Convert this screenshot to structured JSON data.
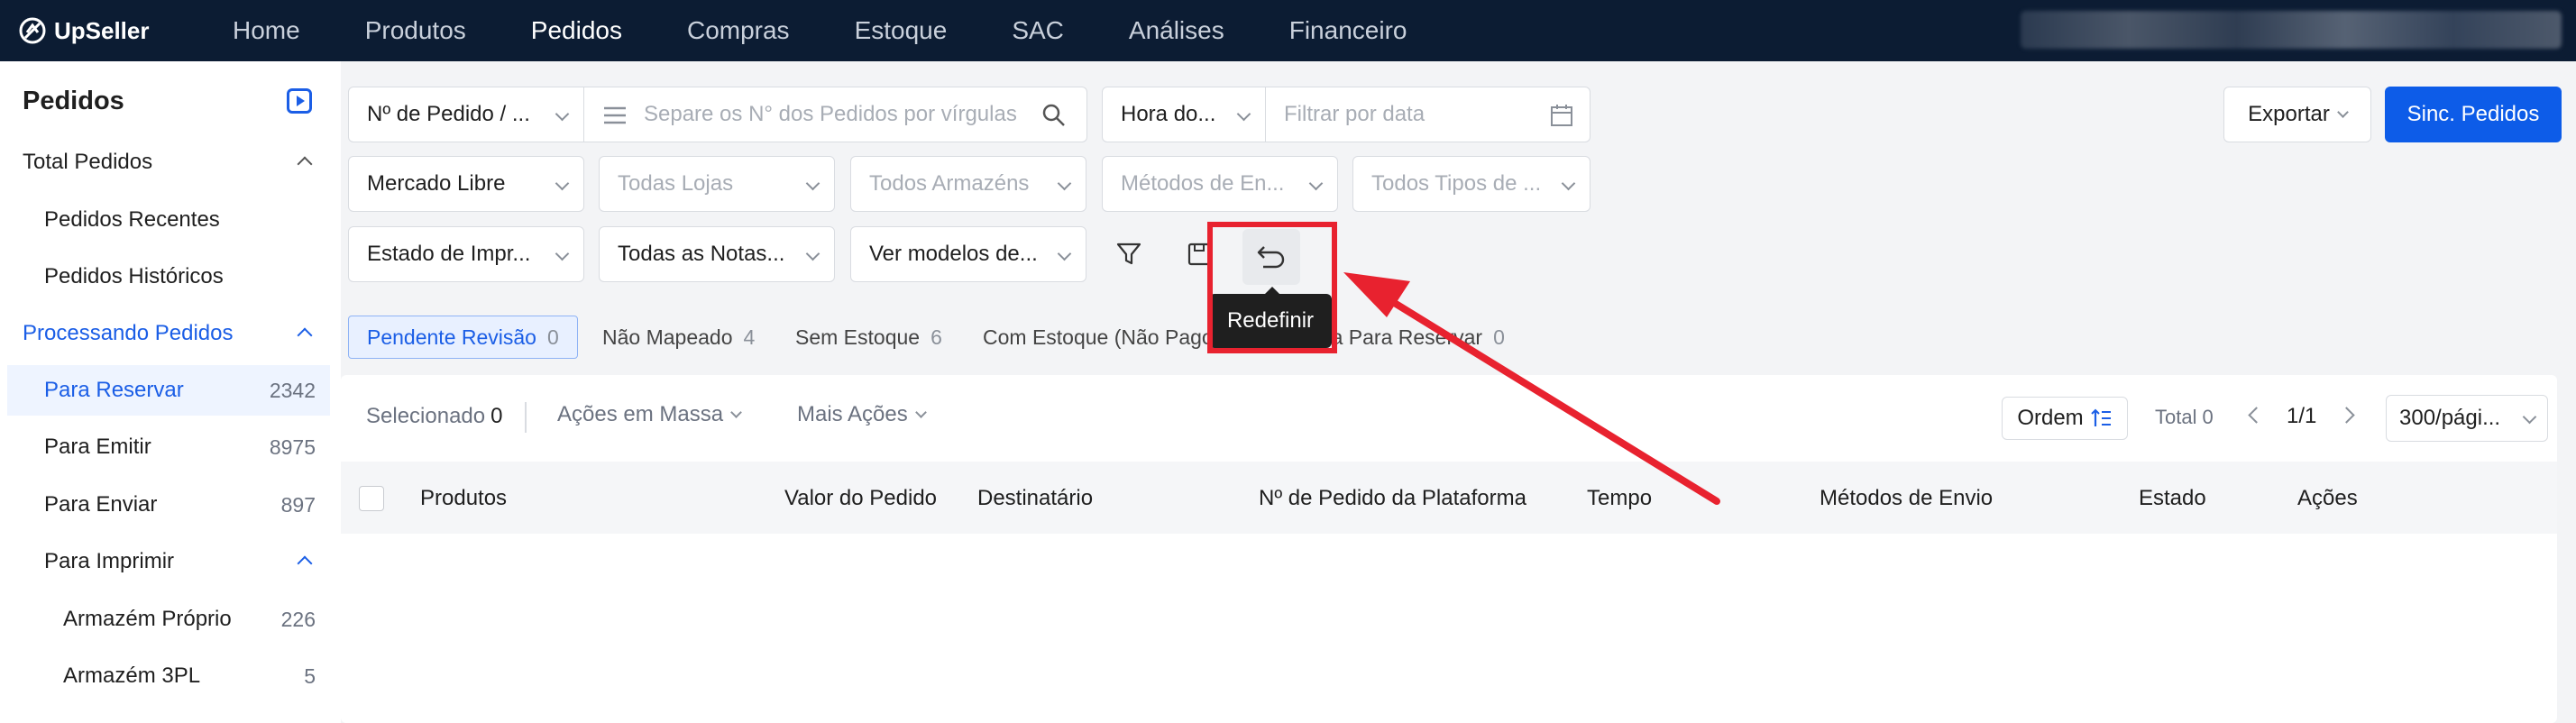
{
  "app": {
    "logo_text": "UpSeller"
  },
  "nav": {
    "items": [
      "Home",
      "Produtos",
      "Pedidos",
      "Compras",
      "Estoque",
      "SAC",
      "Análises",
      "Financeiro"
    ],
    "active": "Pedidos"
  },
  "sidebar": {
    "title": "Pedidos",
    "items": [
      {
        "label": "Total Pedidos",
        "count": ""
      },
      {
        "label": "Pedidos Recentes",
        "count": ""
      },
      {
        "label": "Pedidos Históricos",
        "count": ""
      },
      {
        "label": "Processando Pedidos",
        "count": ""
      },
      {
        "label": "Para Reservar",
        "count": "2342"
      },
      {
        "label": "Para Emitir",
        "count": "8975"
      },
      {
        "label": "Para Enviar",
        "count": "897"
      },
      {
        "label": "Para Imprimir",
        "count": ""
      },
      {
        "label": "Armazém Próprio",
        "count": "226"
      },
      {
        "label": "Armazém 3PL",
        "count": "5"
      }
    ]
  },
  "filters": {
    "order_type": "Nº de Pedido / ...",
    "order_search_placeholder": "Separe os N° dos Pedidos por vírgulas",
    "time_type": "Hora do...",
    "date_placeholder": "Filtrar por data",
    "platform": "Mercado Libre",
    "stores": "Todas Lojas",
    "warehouses": "Todos Armazéns",
    "shipping": "Métodos de En...",
    "types": "Todos Tipos de ...",
    "print_state": "Estado de Impr...",
    "notes": "Todas as Notas...",
    "models": "Ver modelos de..."
  },
  "actions": {
    "export": "Exportar",
    "sync": "Sinc. Pedidos",
    "reset_tooltip": "Redefinir"
  },
  "tabs": [
    {
      "label": "Pendente Revisão",
      "count": "0"
    },
    {
      "label": "Não Mapeado",
      "count": "4"
    },
    {
      "label": "Sem Estoque",
      "count": "6"
    },
    {
      "label": "Com Estoque (Não Pago)",
      "count": ""
    },
    {
      "label": "ica Para Reservar",
      "count": "0"
    }
  ],
  "toolbar": {
    "selected_label": "Selecionado",
    "selected_count": "0",
    "bulk": "Ações em Massa",
    "more": "Mais Ações",
    "order": "Ordem",
    "total_label": "Total",
    "total": "0",
    "page": "1/1",
    "page_size": "300/pági..."
  },
  "table": {
    "columns": [
      "Produtos",
      "Valor do Pedido",
      "Destinatário",
      "Nº de Pedido da Plataforma",
      "Tempo",
      "Métodos de Envio",
      "Estado",
      "Ações"
    ]
  },
  "colors": {
    "nav_bg": "#0c1c33",
    "accent": "#0d5ce8",
    "annotation": "#e8222f"
  }
}
